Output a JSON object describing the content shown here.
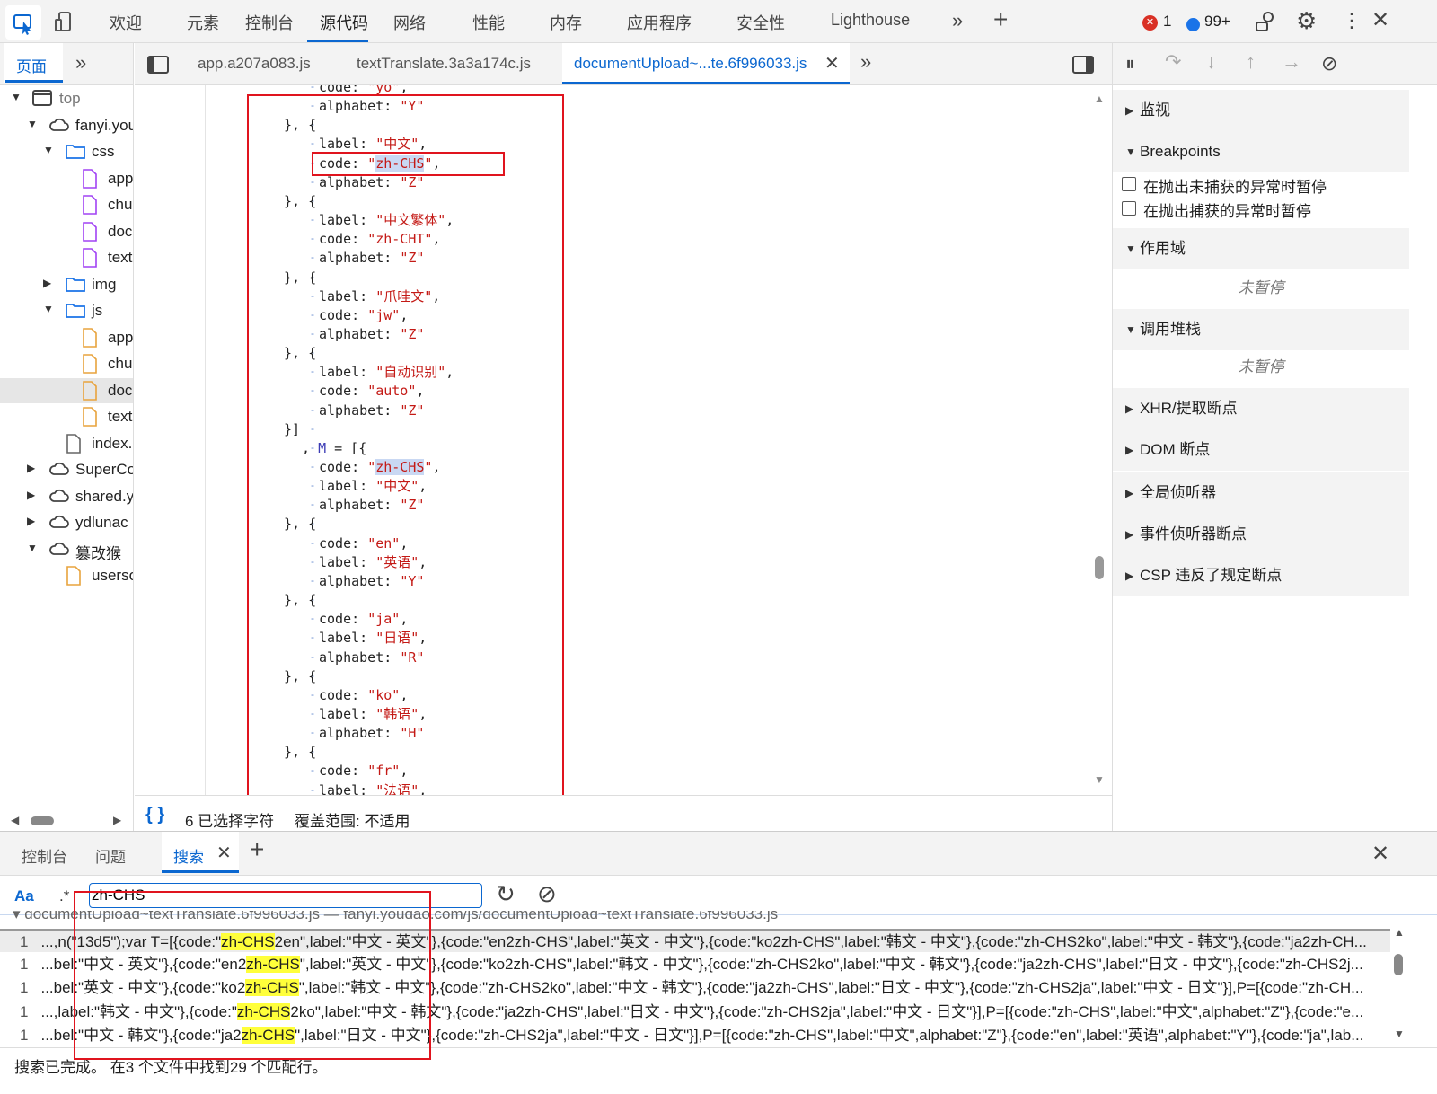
{
  "toolbar": {
    "tabs": [
      "欢迎",
      "元素",
      "控制台",
      "源代码",
      "网络",
      "性能",
      "内存",
      "应用程序",
      "安全性",
      "Lighthouse"
    ],
    "active": "源代码",
    "errors": "1",
    "messages": "99+"
  },
  "navigator": {
    "tab": "页面",
    "tree": [
      {
        "label": "top",
        "icon": "frame",
        "depth": 0,
        "arrow": "down"
      },
      {
        "label": "fanyi.youdao.com",
        "icon": "cloud",
        "depth": 1,
        "arrow": "down"
      },
      {
        "label": "css",
        "icon": "folder",
        "depth": 2,
        "arrow": "down"
      },
      {
        "label": "app",
        "icon": "file-css",
        "depth": 3
      },
      {
        "label": "chu",
        "icon": "file-css",
        "depth": 3
      },
      {
        "label": "doc",
        "icon": "file-css",
        "depth": 3
      },
      {
        "label": "text",
        "icon": "file-css",
        "depth": 3
      },
      {
        "label": "img",
        "icon": "folder",
        "depth": 2,
        "arrow": "right"
      },
      {
        "label": "js",
        "icon": "folder",
        "depth": 2,
        "arrow": "down"
      },
      {
        "label": "app",
        "icon": "file-js",
        "depth": 3
      },
      {
        "label": "chu",
        "icon": "file-js",
        "depth": 3
      },
      {
        "label": "doc",
        "icon": "file-js",
        "depth": 3,
        "selected": true
      },
      {
        "label": "text",
        "icon": "file-js",
        "depth": 3
      },
      {
        "label": "index.",
        "icon": "file",
        "depth": 2
      },
      {
        "label": "SuperCo",
        "icon": "cloud",
        "depth": 1,
        "arrow": "right"
      },
      {
        "label": "shared.y",
        "icon": "cloud",
        "depth": 1,
        "arrow": "right"
      },
      {
        "label": "ydlunac",
        "icon": "cloud",
        "depth": 1,
        "arrow": "right"
      },
      {
        "label": "篡改猴",
        "icon": "cloud",
        "depth": 1,
        "arrow": "down"
      },
      {
        "label": "userso",
        "icon": "file-js",
        "depth": 2
      }
    ]
  },
  "editor": {
    "tabs": [
      "app.a207a083.js",
      "textTranslate.3a3a174c.js",
      "documentUpload~...te.6f996033.js"
    ],
    "active_tab": 2,
    "lines": [
      [
        2,
        "code: \"yo\","
      ],
      [
        2,
        "alphabet: \"Y\""
      ],
      [
        1,
        "}, {"
      ],
      [
        2,
        "label: \"中文\","
      ],
      [
        2,
        "code: \"zh-CHS\",",
        "hl"
      ],
      [
        2,
        "alphabet: \"Z\""
      ],
      [
        1,
        "}, {"
      ],
      [
        2,
        "label: \"中文繁体\","
      ],
      [
        2,
        "code: \"zh-CHT\","
      ],
      [
        2,
        "alphabet: \"Z\""
      ],
      [
        1,
        "}, {"
      ],
      [
        2,
        "label: \"爪哇文\","
      ],
      [
        2,
        "code: \"jw\","
      ],
      [
        2,
        "alphabet: \"Z\""
      ],
      [
        1,
        "}, {"
      ],
      [
        2,
        "label: \"自动识别\","
      ],
      [
        2,
        "code: \"auto\","
      ],
      [
        2,
        "alphabet: \"Z\""
      ],
      [
        1,
        "}]"
      ],
      [
        3,
        ", M = [{"
      ],
      [
        2,
        "code: \"zh-CHS\",",
        "hl"
      ],
      [
        2,
        "label: \"中文\","
      ],
      [
        2,
        "alphabet: \"Z\""
      ],
      [
        1,
        "}, {"
      ],
      [
        2,
        "code: \"en\","
      ],
      [
        2,
        "label: \"英语\","
      ],
      [
        2,
        "alphabet: \"Y\""
      ],
      [
        1,
        "}, {"
      ],
      [
        2,
        "code: \"ja\","
      ],
      [
        2,
        "label: \"日语\","
      ],
      [
        2,
        "alphabet: \"R\""
      ],
      [
        1,
        "}, {"
      ],
      [
        2,
        "code: \"ko\","
      ],
      [
        2,
        "label: \"韩语\","
      ],
      [
        2,
        "alphabet: \"H\""
      ],
      [
        1,
        "}, {"
      ],
      [
        2,
        "code: \"fr\","
      ],
      [
        2,
        "label: \"法语\","
      ]
    ],
    "status": {
      "braces": "{ }",
      "selected": "6 已选择字符",
      "coverage": "覆盖范围: 不适用"
    }
  },
  "debugger": {
    "sections": [
      {
        "label": "监视",
        "open": false
      },
      {
        "label": "Breakpoints",
        "open": true
      },
      {
        "label": "作用域",
        "open": true
      },
      {
        "label": "调用堆栈",
        "open": true
      },
      {
        "label": "XHR/提取断点",
        "open": false
      },
      {
        "label": "DOM 断点",
        "open": false
      },
      {
        "label": "全局侦听器",
        "open": false
      },
      {
        "label": "事件侦听器断点",
        "open": false
      },
      {
        "label": "CSP 违反了规定断点",
        "open": false
      }
    ],
    "checkboxes": [
      "在抛出未捕获的异常时暂停",
      "在抛出捕获的异常时暂停"
    ],
    "not_paused": "未暂停"
  },
  "drawer": {
    "tabs": [
      "控制台",
      "问题",
      "搜索"
    ],
    "active": "搜索",
    "search": {
      "case_label": "Aa",
      "regex_label": ".*",
      "query": "zh-CHS"
    },
    "file_header": "documentUpload~textTranslate.6f996033.js — fanyi.youdao.com/js/documentUpload~textTranslate.6f996033.js",
    "results": [
      {
        "line": "1",
        "pre": "...,n(\"13d5\");var T=[{code:\"",
        "match": "zh-CHS",
        "post": "2en\",label:\"中文 - 英文\"},{code:\"en2zh-CHS\",label:\"英文 - 中文\"},{code:\"ko2zh-CHS\",label:\"韩文 - 中文\"},{code:\"zh-CHS2ko\",label:\"中文 - 韩文\"},{code:\"ja2zh-CH..."
      },
      {
        "line": "1",
        "pre": "...bel:\"中文 - 英文\"},{code:\"en2",
        "match": "zh-CHS",
        "post": "\",label:\"英文 - 中文\"},{code:\"ko2zh-CHS\",label:\"韩文 - 中文\"},{code:\"zh-CHS2ko\",label:\"中文 - 韩文\"},{code:\"ja2zh-CHS\",label:\"日文 - 中文\"},{code:\"zh-CHS2j..."
      },
      {
        "line": "1",
        "pre": "...bel:\"英文 - 中文\"},{code:\"ko2",
        "match": "zh-CHS",
        "post": "\",label:\"韩文 - 中文\"},{code:\"zh-CHS2ko\",label:\"中文 - 韩文\"},{code:\"ja2zh-CHS\",label:\"日文 - 中文\"},{code:\"zh-CHS2ja\",label:\"中文 - 日文\"}],P=[{code:\"zh-CH..."
      },
      {
        "line": "1",
        "pre": "...,label:\"韩文 - 中文\"},{code:\"",
        "match": "zh-CHS",
        "post": "2ko\",label:\"中文 - 韩文\"},{code:\"ja2zh-CHS\",label:\"日文 - 中文\"},{code:\"zh-CHS2ja\",label:\"中文 - 日文\"}],P=[{code:\"zh-CHS\",label:\"中文\",alphabet:\"Z\"},{code:\"e..."
      },
      {
        "line": "1",
        "pre": "...bel:\"中文 - 韩文\"},{code:\"ja2",
        "match": "zh-CHS",
        "post": "\",label:\"日文 - 中文\"},{code:\"zh-CHS2ja\",label:\"中文 - 日文\"}],P=[{code:\"zh-CHS\",label:\"中文\",alphabet:\"Z\"},{code:\"en\",label:\"英语\",alphabet:\"Y\"},{code:\"ja\",lab..."
      }
    ],
    "footer": "搜索已完成。 在3 个文件中找到29 个匹配行。"
  },
  "colors": {
    "accent": "#0b67d0",
    "annotation": "#e0141e",
    "match": "#ffff3a",
    "string": "#c41a16"
  }
}
